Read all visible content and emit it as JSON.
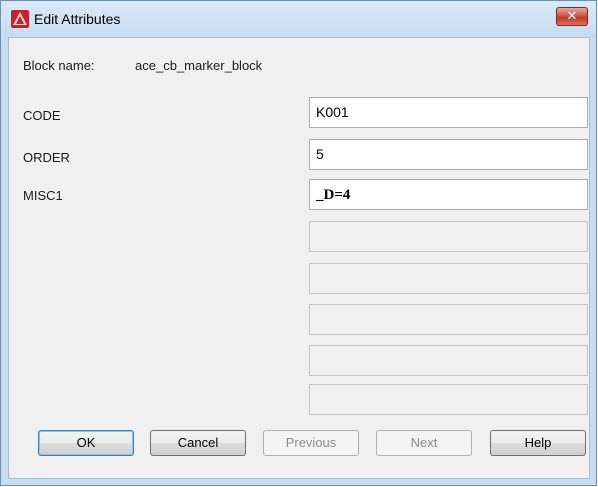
{
  "window": {
    "title": "Edit Attributes",
    "close_glyph": "✕"
  },
  "block": {
    "label": "Block name:",
    "value": "ace_cb_marker_block"
  },
  "attributes": [
    {
      "label": "CODE",
      "value": "K001"
    },
    {
      "label": "ORDER",
      "value": "5"
    },
    {
      "label": "MISC1",
      "value": "_D=4"
    }
  ],
  "buttons": {
    "ok": "OK",
    "cancel": "Cancel",
    "previous": "Previous",
    "next": "Next",
    "help": "Help"
  },
  "icons": {
    "app": "autocad-app-icon",
    "close": "close-icon"
  },
  "colors": {
    "app_icon": "#c8202a",
    "close_button": "#c84a3a",
    "default_button_border": "#3c7fb1"
  }
}
